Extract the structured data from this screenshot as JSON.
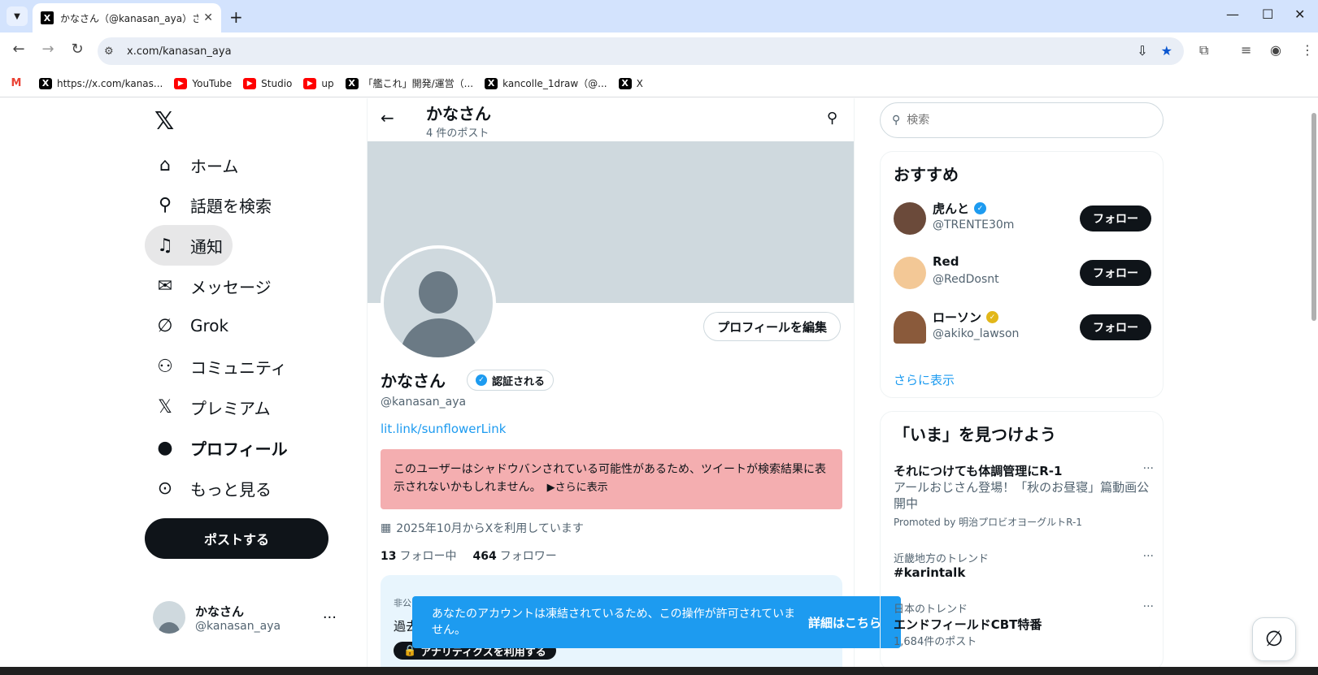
{
  "browser": {
    "tab_title": "かなさん（@kanasan_aya）さん / X",
    "url": "x.com/kanasan_aya",
    "bookmarks": [
      "https://x.com/kanas...",
      "YouTube",
      "Studio",
      "up",
      "「艦これ」開発/運営（...",
      "kancolle_1draw（@...",
      "X"
    ]
  },
  "leftnav": {
    "items": [
      {
        "icon": "home-icon",
        "label": "ホーム"
      },
      {
        "icon": "search-icon",
        "label": "話題を検索"
      },
      {
        "icon": "bell-icon",
        "label": "通知"
      },
      {
        "icon": "mail-icon",
        "label": "メッセージ"
      },
      {
        "icon": "grok-icon",
        "label": "Grok"
      },
      {
        "icon": "community-icon",
        "label": "コミュニティ"
      },
      {
        "icon": "x-icon",
        "label": "プレミアム"
      },
      {
        "icon": "person-icon",
        "label": "プロフィール"
      },
      {
        "icon": "more-icon",
        "label": "もっと見る"
      }
    ],
    "post_label": "ポストする",
    "me": {
      "name": "かなさん",
      "handle": "@kanasan_aya"
    }
  },
  "profile": {
    "header_title": "かなさん",
    "header_sub": "4 件のポスト",
    "edit_label": "プロフィールを編集",
    "name": "かなさん",
    "verify_label": "認証される",
    "handle": "@kanasan_aya",
    "link": "lit.link/sunflowerLink",
    "warning": "このユーザーはシャドウバンされている可能性があるため、ツイートが検索結果に表示されないかもしれません。",
    "warning_more": "▶さらに表示",
    "joined": "2025年10月からXを利用しています",
    "following_count": "13",
    "following_label": "フォロー中",
    "followers_count": "464",
    "followers_label": "フォロワー",
    "analytics_label1": "非公",
    "analytics_label2": "過去",
    "analytics_button": "アナリティクスを利用する"
  },
  "toast": {
    "message": "あなたのアカウントは凍結されているため、この操作が許可されていません。",
    "link": "詳細はこちら"
  },
  "right": {
    "search_placeholder": "検索",
    "recommend_title": "おすすめ",
    "suggestions": [
      {
        "name": "虎んと",
        "handle": "@TRENTE30m",
        "badge_color": "#1d9bf0",
        "follow": "フォロー"
      },
      {
        "name": "Red",
        "handle": "@RedDosnt",
        "badge_color": "",
        "follow": "フォロー"
      },
      {
        "name": "ローソン",
        "handle": "@akiko_lawson",
        "badge_color": "#e2b719",
        "follow": "フォロー"
      }
    ],
    "show_more": "さらに表示",
    "trends_title": "「いま」を見つけよう",
    "trends": [
      {
        "title": "それにつけても体調管理にR-1",
        "desc": "アールおじさん登場！「秋のお昼寝」篇動画公開中",
        "promo": "Promoted by 明治プロビオヨーグルトR-1"
      },
      {
        "context": "近畿地方のトレンド",
        "title": "#karintalk"
      },
      {
        "context": "日本のトレンド",
        "title": "エンドフィールドCBT特番",
        "count": "1,684件のポスト"
      }
    ]
  }
}
